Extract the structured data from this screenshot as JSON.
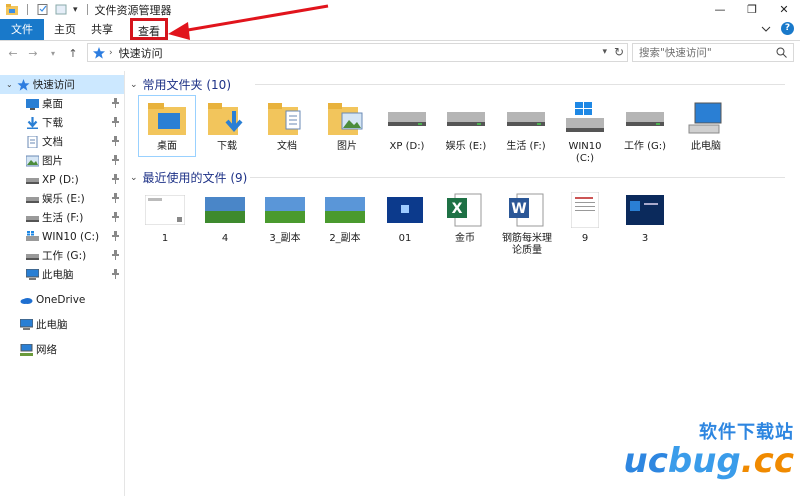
{
  "window": {
    "title": "文件资源管理器",
    "controls": [
      "minimize-icon",
      "maximize-icon",
      "close-icon"
    ]
  },
  "ribbon": {
    "tabs": [
      "文件",
      "主页",
      "共享",
      "查看"
    ],
    "highlighted_tab": "查看",
    "accent_color": "#1979ca",
    "highlight_color": "#d5151d"
  },
  "address": {
    "path": "快速访问",
    "search_placeholder": "搜索\"快速访问\""
  },
  "sidebar": {
    "quick_access": "快速访问",
    "pinned": [
      "桌面",
      "下载",
      "文档",
      "图片",
      "XP (D:)",
      "娱乐 (E:)",
      "生活 (F:)",
      "WIN10 (C:)",
      "工作 (G:)",
      "此电脑"
    ],
    "onedrive": "OneDrive",
    "this_pc": "此电脑",
    "network": "网络"
  },
  "groups": {
    "frequent": {
      "header": "常用文件夹 (10)",
      "items": [
        "桌面",
        "下载",
        "文档",
        "图片",
        "XP (D:)",
        "娱乐 (E:)",
        "生活 (F:)",
        "WIN10 (C:)",
        "工作 (G:)",
        "此电脑"
      ]
    },
    "recent": {
      "header": "最近使用的文件 (9)",
      "items": [
        "1",
        "4",
        "3_副本",
        "2_副本",
        "01",
        "金币",
        "钢筋每米理论质量",
        "9",
        "3"
      ]
    }
  },
  "watermark": {
    "cn": "软件下载站",
    "en_a": "uc",
    "en_b": "bug",
    "en_c": ".cc"
  }
}
